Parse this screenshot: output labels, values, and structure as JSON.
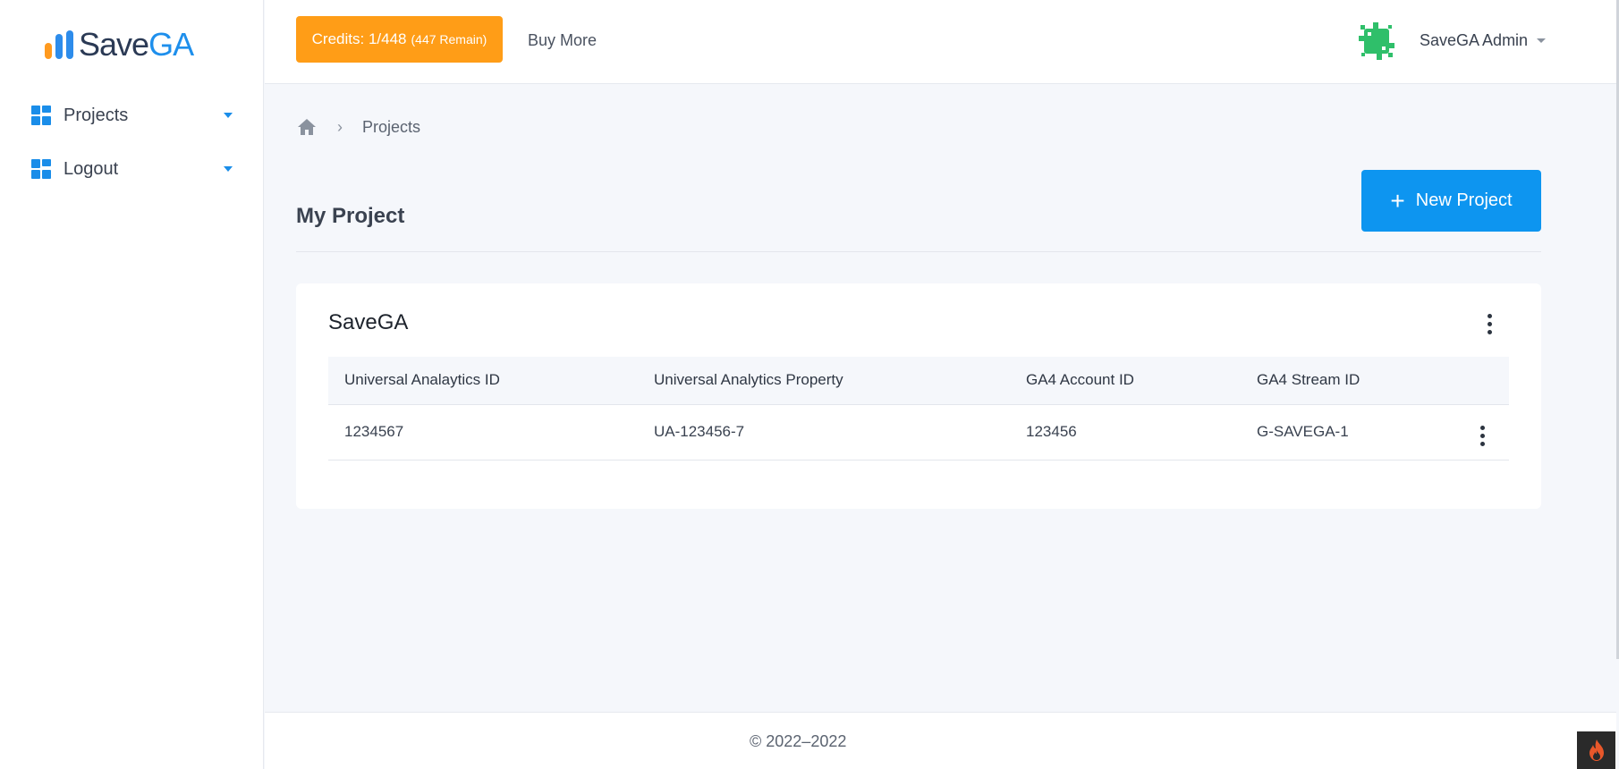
{
  "brand": {
    "logo_part1": "Save",
    "logo_part2": "GA",
    "colors": {
      "accent": "#0d95f0",
      "credits": "#ff9d17",
      "logo_orange": "#ff9a1f",
      "logo_blue": "#2d8ceb"
    }
  },
  "sidebar": {
    "items": [
      {
        "label": "Projects",
        "icon": "grid-icon"
      },
      {
        "label": "Logout",
        "icon": "grid-icon"
      }
    ]
  },
  "header": {
    "credits_label": "Credits: 1/448",
    "credits_remain": "(447 Remain)",
    "buy_more": "Buy More",
    "user_name": "SaveGA Admin"
  },
  "breadcrumb": {
    "current": "Projects"
  },
  "main": {
    "title": "My Project",
    "new_project_label": "New Project"
  },
  "project_card": {
    "title": "SaveGA",
    "columns": [
      "Universal Analaytics ID",
      "Universal Analytics Property",
      "GA4 Account ID",
      "GA4 Stream ID"
    ],
    "rows": [
      [
        "1234567",
        "UA-123456-7",
        "123456",
        "G-SAVEGA-1"
      ]
    ]
  },
  "footer": {
    "copyright": "© 2022–2022"
  }
}
